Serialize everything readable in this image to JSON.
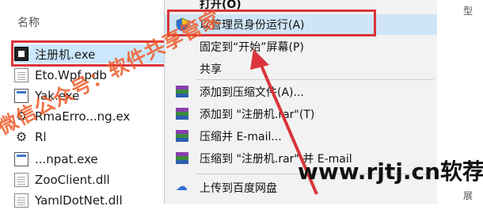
{
  "explorer": {
    "column_header": "名称",
    "files": [
      {
        "name": "注册机.exe",
        "icon": "exe-dark-icon",
        "selected": true
      },
      {
        "name": "Eto.Wpf.pdb",
        "icon": "document-icon"
      },
      {
        "name": "Yak.exe",
        "icon": "exe-window-icon"
      },
      {
        "name": "RmaErro...ng.ex",
        "icon": "gear-exe-icon"
      },
      {
        "name": "Rl",
        "icon": "gear-exe-icon"
      },
      {
        "name": "...npat.exe",
        "icon": "exe-window-icon"
      },
      {
        "name": "ZooClient.dll",
        "icon": "document-icon"
      },
      {
        "name": "YamlDotNet.dll",
        "icon": "document-icon"
      }
    ]
  },
  "context_menu": {
    "items": [
      {
        "label": "打开(O)",
        "icon": ""
      },
      {
        "label": "以管理员身份运行(A)",
        "icon": "uac-shield-icon",
        "highlighted": true
      },
      {
        "label": "固定到“开始”屏幕(P)",
        "icon": ""
      },
      {
        "label": "共享",
        "icon": ""
      },
      {
        "label": "添加到压缩文件(A)...",
        "icon": "winrar-icon"
      },
      {
        "label": "添加到 \"注册机.rar\"(T)",
        "icon": "winrar-icon"
      },
      {
        "label": "压缩并 E-mail...",
        "icon": "winrar-icon"
      },
      {
        "label": "压缩到 \"注册机.rar\" 并 E-mail",
        "icon": "winrar-icon"
      },
      {
        "label": "上传到百度网盘",
        "icon": "baidu-netdisk-icon"
      }
    ]
  },
  "right_strip": {
    "texts": [
      "型",
      "展"
    ]
  },
  "watermarks": {
    "diagonal": "微信公众号：软件共享管家",
    "url": "www.rjtj.cn软荐网"
  },
  "colors": {
    "highlight_box": "#d9353b",
    "selection": "#cce8ff",
    "menu_highlight": "#cfe5f7",
    "watermark": "#f05a28"
  }
}
